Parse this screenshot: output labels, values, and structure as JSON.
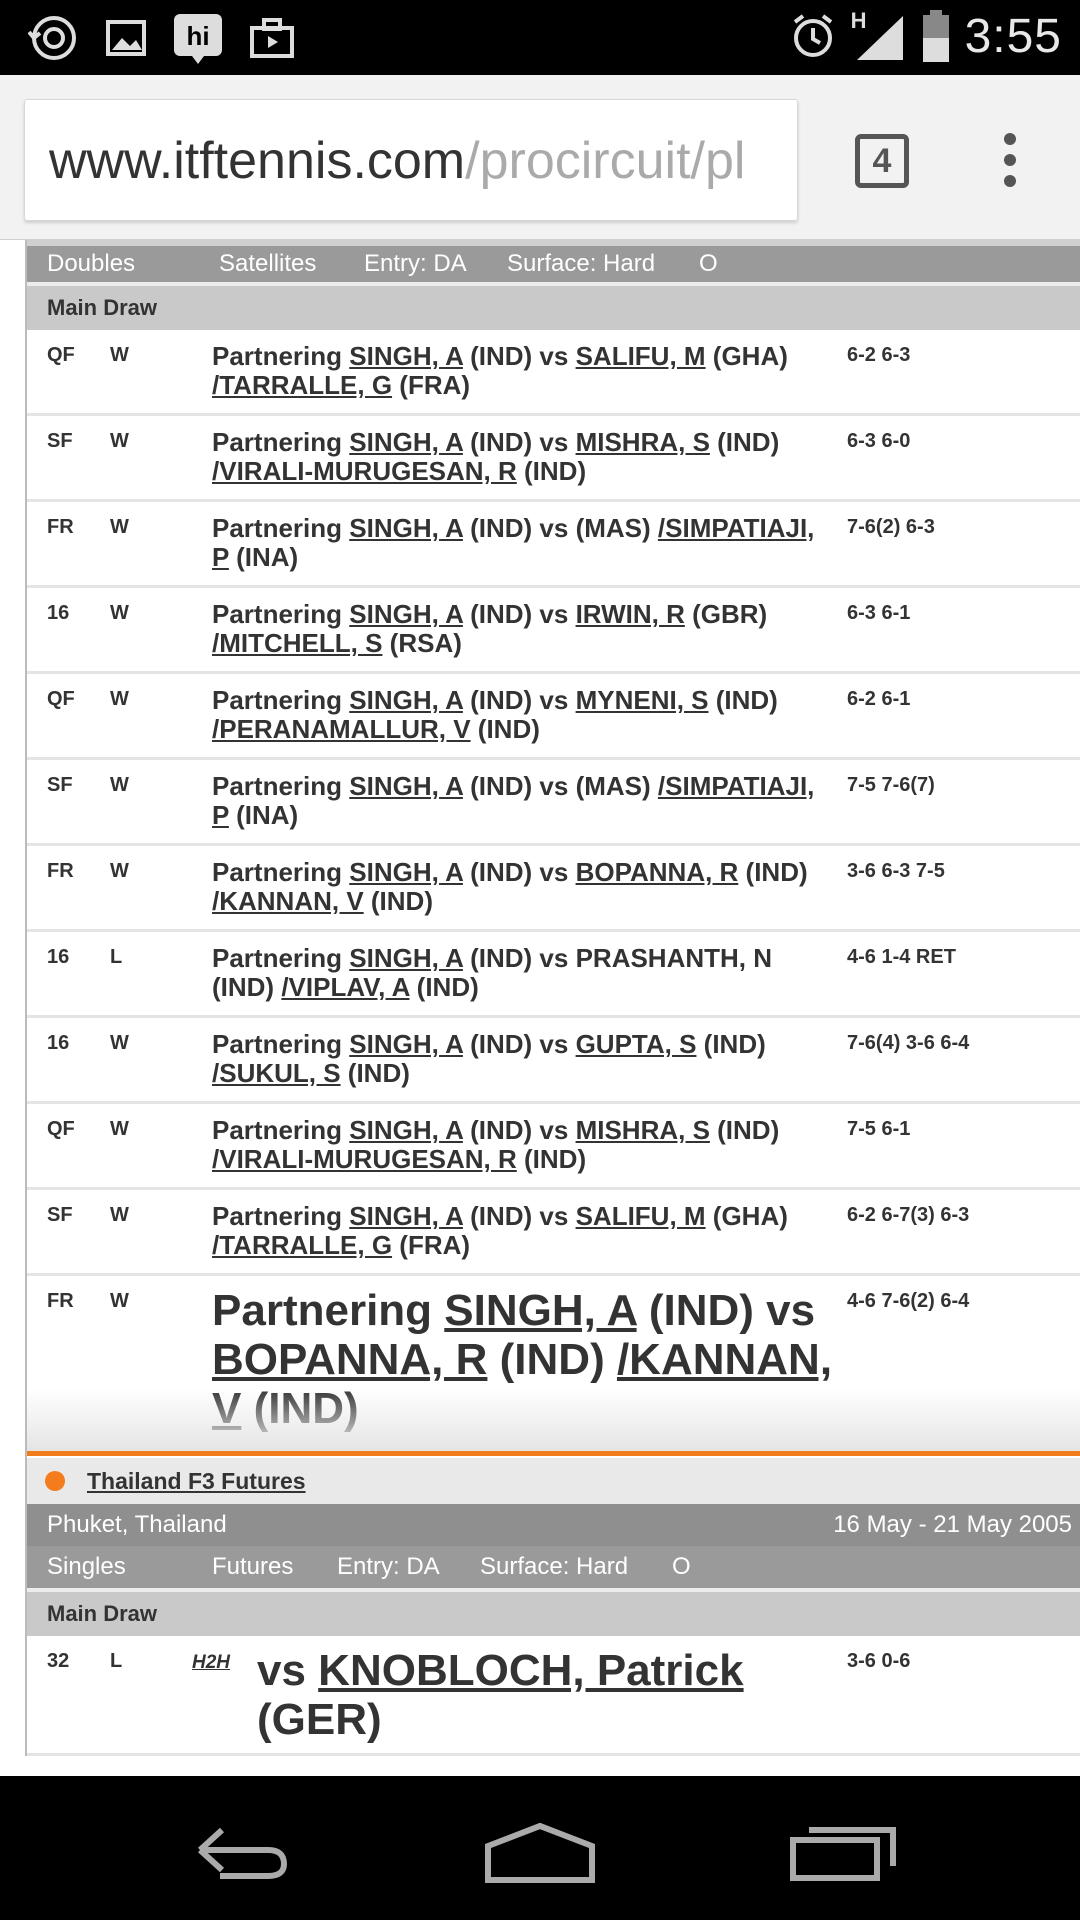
{
  "status_bar": {
    "time": "3:55",
    "network": "H",
    "icons": [
      "sync-icon",
      "image-icon",
      "hi-app-icon",
      "briefcase-icon",
      "alarm-icon",
      "signal-icon",
      "battery-icon"
    ]
  },
  "browser": {
    "url_host": "www.itftennis.com",
    "url_path": "/procircuit/pl",
    "tab_count": "4"
  },
  "section1": {
    "info": {
      "type": "Doubles",
      "category": "Satellites",
      "entry": "Entry: DA",
      "surface": "Surface: Hard",
      "extra": "O"
    },
    "draw_label": "Main Draw",
    "matches": [
      {
        "round": "QF",
        "result": "W",
        "prefix": "Partnering ",
        "partner": "SINGH, A",
        "mid1": " (IND) vs ",
        "opp1": "SALIFU, M",
        "mid2": " (GHA) ",
        "opp2": "/TARRALLE, G",
        "suffix": " (FRA)",
        "score": "6-2 6-3"
      },
      {
        "round": "SF",
        "result": "W",
        "prefix": "Partnering ",
        "partner": "SINGH, A",
        "mid1": " (IND) vs ",
        "opp1": "MISHRA, S",
        "mid2": " (IND) ",
        "opp2": "/VIRALI-MURUGESAN, R",
        "suffix": " (IND)",
        "score": "6-3 6-0"
      },
      {
        "round": "FR",
        "result": "W",
        "prefix": "Partnering ",
        "partner": "SINGH, A",
        "mid1": " (IND) vs ",
        "opp1": "",
        "mid2": "(MAS) ",
        "opp2": "/SIMPATIAJI, P",
        "suffix": " (INA)",
        "score": "7-6(2) 6-3"
      },
      {
        "round": "16",
        "result": "W",
        "prefix": "Partnering ",
        "partner": "SINGH, A",
        "mid1": " (IND) vs ",
        "opp1": "IRWIN, R",
        "mid2": " (GBR) ",
        "opp2": "/MITCHELL, S",
        "suffix": " (RSA)",
        "score": "6-3 6-1"
      },
      {
        "round": "QF",
        "result": "W",
        "prefix": "Partnering ",
        "partner": "SINGH, A",
        "mid1": " (IND) vs ",
        "opp1": "MYNENI, S",
        "mid2": " (IND) ",
        "opp2": "/PERANAMALLUR, V",
        "suffix": " (IND)",
        "score": "6-2 6-1"
      },
      {
        "round": "SF",
        "result": "W",
        "prefix": "Partnering ",
        "partner": "SINGH, A",
        "mid1": " (IND) vs ",
        "opp1": "",
        "mid2": "(MAS) ",
        "opp2": "/SIMPATIAJI, P",
        "suffix": " (INA)",
        "score": "7-5 7-6(7)"
      },
      {
        "round": "FR",
        "result": "W",
        "prefix": "Partnering ",
        "partner": "SINGH, A",
        "mid1": " (IND) vs ",
        "opp1": "BOPANNA, R",
        "mid2": " (IND) ",
        "opp2": "/KANNAN, V",
        "suffix": " (IND)",
        "score": "3-6 6-3 7-5"
      },
      {
        "round": "16",
        "result": "L",
        "prefix": "Partnering ",
        "partner": "SINGH, A",
        "mid1": " (IND) vs PRASHANTH, N",
        "opp1": "",
        "mid2": " (IND) ",
        "opp2": "/VIPLAV, A",
        "suffix": " (IND)",
        "score": "4-6 1-4 RET"
      },
      {
        "round": "16",
        "result": "W",
        "prefix": "Partnering ",
        "partner": "SINGH, A",
        "mid1": " (IND) vs ",
        "opp1": "GUPTA, S",
        "mid2": " (IND) ",
        "opp2": "/SUKUL, S",
        "suffix": " (IND)",
        "score": "7-6(4) 3-6 6-4"
      },
      {
        "round": "QF",
        "result": "W",
        "prefix": "Partnering ",
        "partner": "SINGH, A",
        "mid1": " (IND) vs ",
        "opp1": "MISHRA, S",
        "mid2": " (IND) ",
        "opp2": "/VIRALI-MURUGESAN, R",
        "suffix": " (IND)",
        "score": "7-5 6-1"
      },
      {
        "round": "SF",
        "result": "W",
        "prefix": "Partnering ",
        "partner": "SINGH, A",
        "mid1": " (IND) vs ",
        "opp1": "SALIFU, M",
        "mid2": " (GHA) ",
        "opp2": "/TARRALLE, G",
        "suffix": " (FRA)",
        "score": "6-2 6-7(3) 6-3"
      },
      {
        "round": "FR",
        "result": "W",
        "prefix": "Partnering ",
        "partner": "SINGH, A",
        "mid1": " (IND) vs ",
        "opp1": "BOPANNA, R",
        "mid2": " (IND) ",
        "opp2": "/KANNAN, V",
        "suffix": " (IND)",
        "score": "4-6 7-6(2) 6-4"
      }
    ]
  },
  "section2": {
    "tournament": "Thailand F3 Futures",
    "location": "Phuket, Thailand",
    "dates": "16 May - 21 May 2005",
    "info": {
      "type": "Singles",
      "category": "Futures",
      "entry": "Entry: DA",
      "surface": "Surface: Hard",
      "extra": "O"
    },
    "draw_label": "Main Draw",
    "matches": [
      {
        "round": "32",
        "result": "L",
        "h2h": "H2H",
        "prefix": "vs ",
        "opponent": "KNOBLOCH, Patrick",
        "suffix": " (GER)",
        "score": "3-6 0-6"
      }
    ]
  },
  "colors": {
    "accent": "#f57c1c",
    "info_bar": "#9a9a9a",
    "draw_bar": "#c9c9c9"
  }
}
